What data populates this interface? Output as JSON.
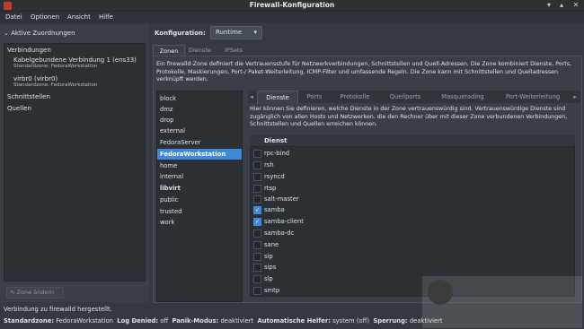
{
  "window": {
    "title": "Firewall-Konfiguration"
  },
  "menu": [
    "Datei",
    "Optionen",
    "Ansicht",
    "Hilfe"
  ],
  "left": {
    "header": "Aktive Zuordnungen",
    "tree": [
      {
        "label": "Verbindungen",
        "sub": ""
      },
      {
        "label": "Kabelgebundene Verbindung 1 (ens33)",
        "sub": "Standardzone: FedoraWorkstation"
      },
      {
        "label": "virbr0 (virbr0)",
        "sub": "Standardzone: FedoraWorkstation"
      },
      {
        "label": "Schnittstellen",
        "sub": ""
      },
      {
        "label": "Quellen",
        "sub": ""
      }
    ],
    "zone_change_btn": "Zone ändern"
  },
  "config": {
    "label": "Konfiguration:",
    "value": "Runtime"
  },
  "top_tabs": [
    "Zonen",
    "Dienste",
    "IPSets"
  ],
  "zone_description": "Ein firewalld-Zone definiert die Vertrauensstufe für Netzwerkverbindungen, Schnittstellen und Quell-Adressen. Die Zone kombiniert Dienste, Ports, Protokolle, Maskierungen, Port-/ Paket-Weiterleitung, ICMP-Filter und umfassende Regeln. Die Zone kann mit Schnittstellen und Quelladressen verknüpft werden.",
  "zones": [
    "block",
    "dmz",
    "drop",
    "external",
    "FedoraServer",
    "FedoraWorkstation",
    "home",
    "internal",
    "libvirt",
    "public",
    "trusted",
    "work"
  ],
  "selected_zone": "FedoraWorkstation",
  "svc_tabs": [
    "Dienste",
    "Ports",
    "Protokolle",
    "Quellports",
    "Masquerading",
    "Port-Weiterleitung"
  ],
  "svc_description": "Hier können Sie definieren, welche Dienste in der Zone vertrauenswürdig sind. Vertrauenswürdige Dienste sind zugänglich von allen Hosts und Netzwerken. die den Rechner über mit dieser Zone verbundenen Verbindungen, Schnittstellen und Quellen erreichen können.",
  "svc_header": "Dienst",
  "services": [
    {
      "name": "rpc-bind",
      "checked": false
    },
    {
      "name": "rsh",
      "checked": false
    },
    {
      "name": "rsyncd",
      "checked": false
    },
    {
      "name": "rtsp",
      "checked": false
    },
    {
      "name": "salt-master",
      "checked": false
    },
    {
      "name": "samba",
      "checked": true
    },
    {
      "name": "samba-client",
      "checked": true
    },
    {
      "name": "samba-dc",
      "checked": false
    },
    {
      "name": "sane",
      "checked": false
    },
    {
      "name": "sip",
      "checked": false
    },
    {
      "name": "sips",
      "checked": false
    },
    {
      "name": "slp",
      "checked": false
    },
    {
      "name": "smtp",
      "checked": false
    }
  ],
  "status": {
    "message": "Verbindung zu firewalld hergestellt.",
    "items": [
      {
        "label": "Standardzone:",
        "value": "FedoraWorkstation"
      },
      {
        "label": "Log Denied:",
        "value": "off"
      },
      {
        "label": "Panik-Modus:",
        "value": "deaktiviert"
      },
      {
        "label": "Automatische Helfer:",
        "value": "system (off)"
      },
      {
        "label": "Sperrung:",
        "value": "deaktiviert"
      }
    ]
  },
  "colors": {
    "accent": "#3f8ad8",
    "background": "#353a40"
  }
}
